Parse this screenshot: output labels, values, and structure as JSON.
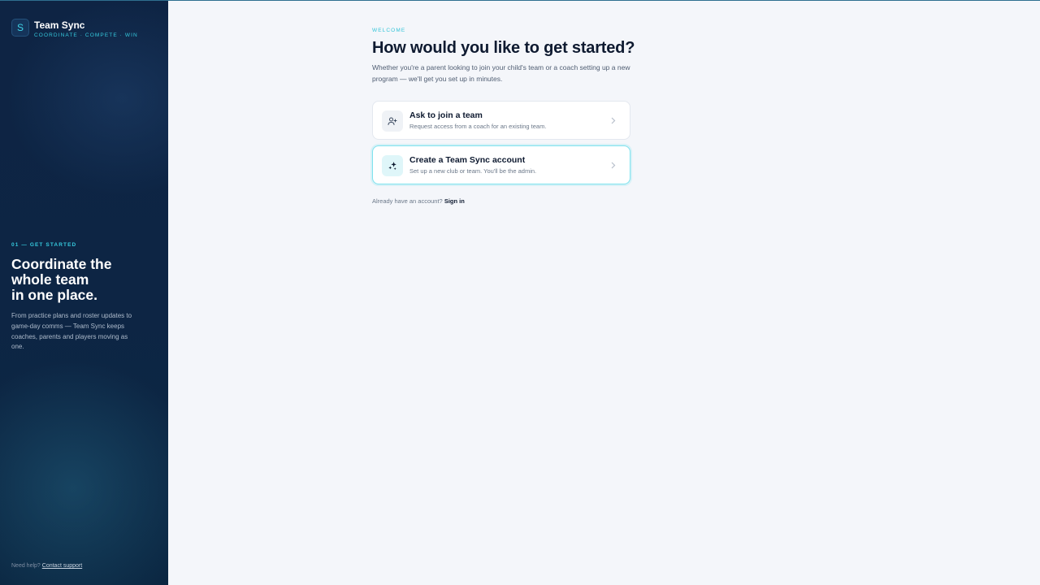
{
  "brand": {
    "logo_letter": "S",
    "name": "Team Sync",
    "tagline": "COORDINATE · COMPETE · WIN"
  },
  "sidebar": {
    "step_kicker": "01 — GET STARTED",
    "title_lines": [
      "Coordinate the",
      "whole team",
      "in one place."
    ],
    "description": "From practice plans and roster updates to game-day comms — Team Sync keeps coaches, parents and players moving as one.",
    "help_prefix": "Need help?",
    "help_link": "Contact support"
  },
  "main": {
    "kicker": "WELCOME",
    "headline": "How would you like to get started?",
    "subtext": "Whether you're a parent looking to join your child's team or a coach setting up a new program — we'll get you set up in minutes."
  },
  "options": [
    {
      "title": "Ask to join a team",
      "description": "Request access from a coach for an existing team.",
      "icon": "user-plus-icon"
    },
    {
      "title": "Create a Team Sync account",
      "description": "Set up a new club or team. You'll be the admin.",
      "icon": "sparkles-icon"
    }
  ],
  "signin": {
    "prompt": "Already have an account?",
    "link": "Sign in"
  },
  "colors": {
    "accent": "#35c9dd",
    "sidebar_bg": "#0e2444",
    "page_bg": "#f4f6fa",
    "selected_border": "#7fe2ee"
  }
}
